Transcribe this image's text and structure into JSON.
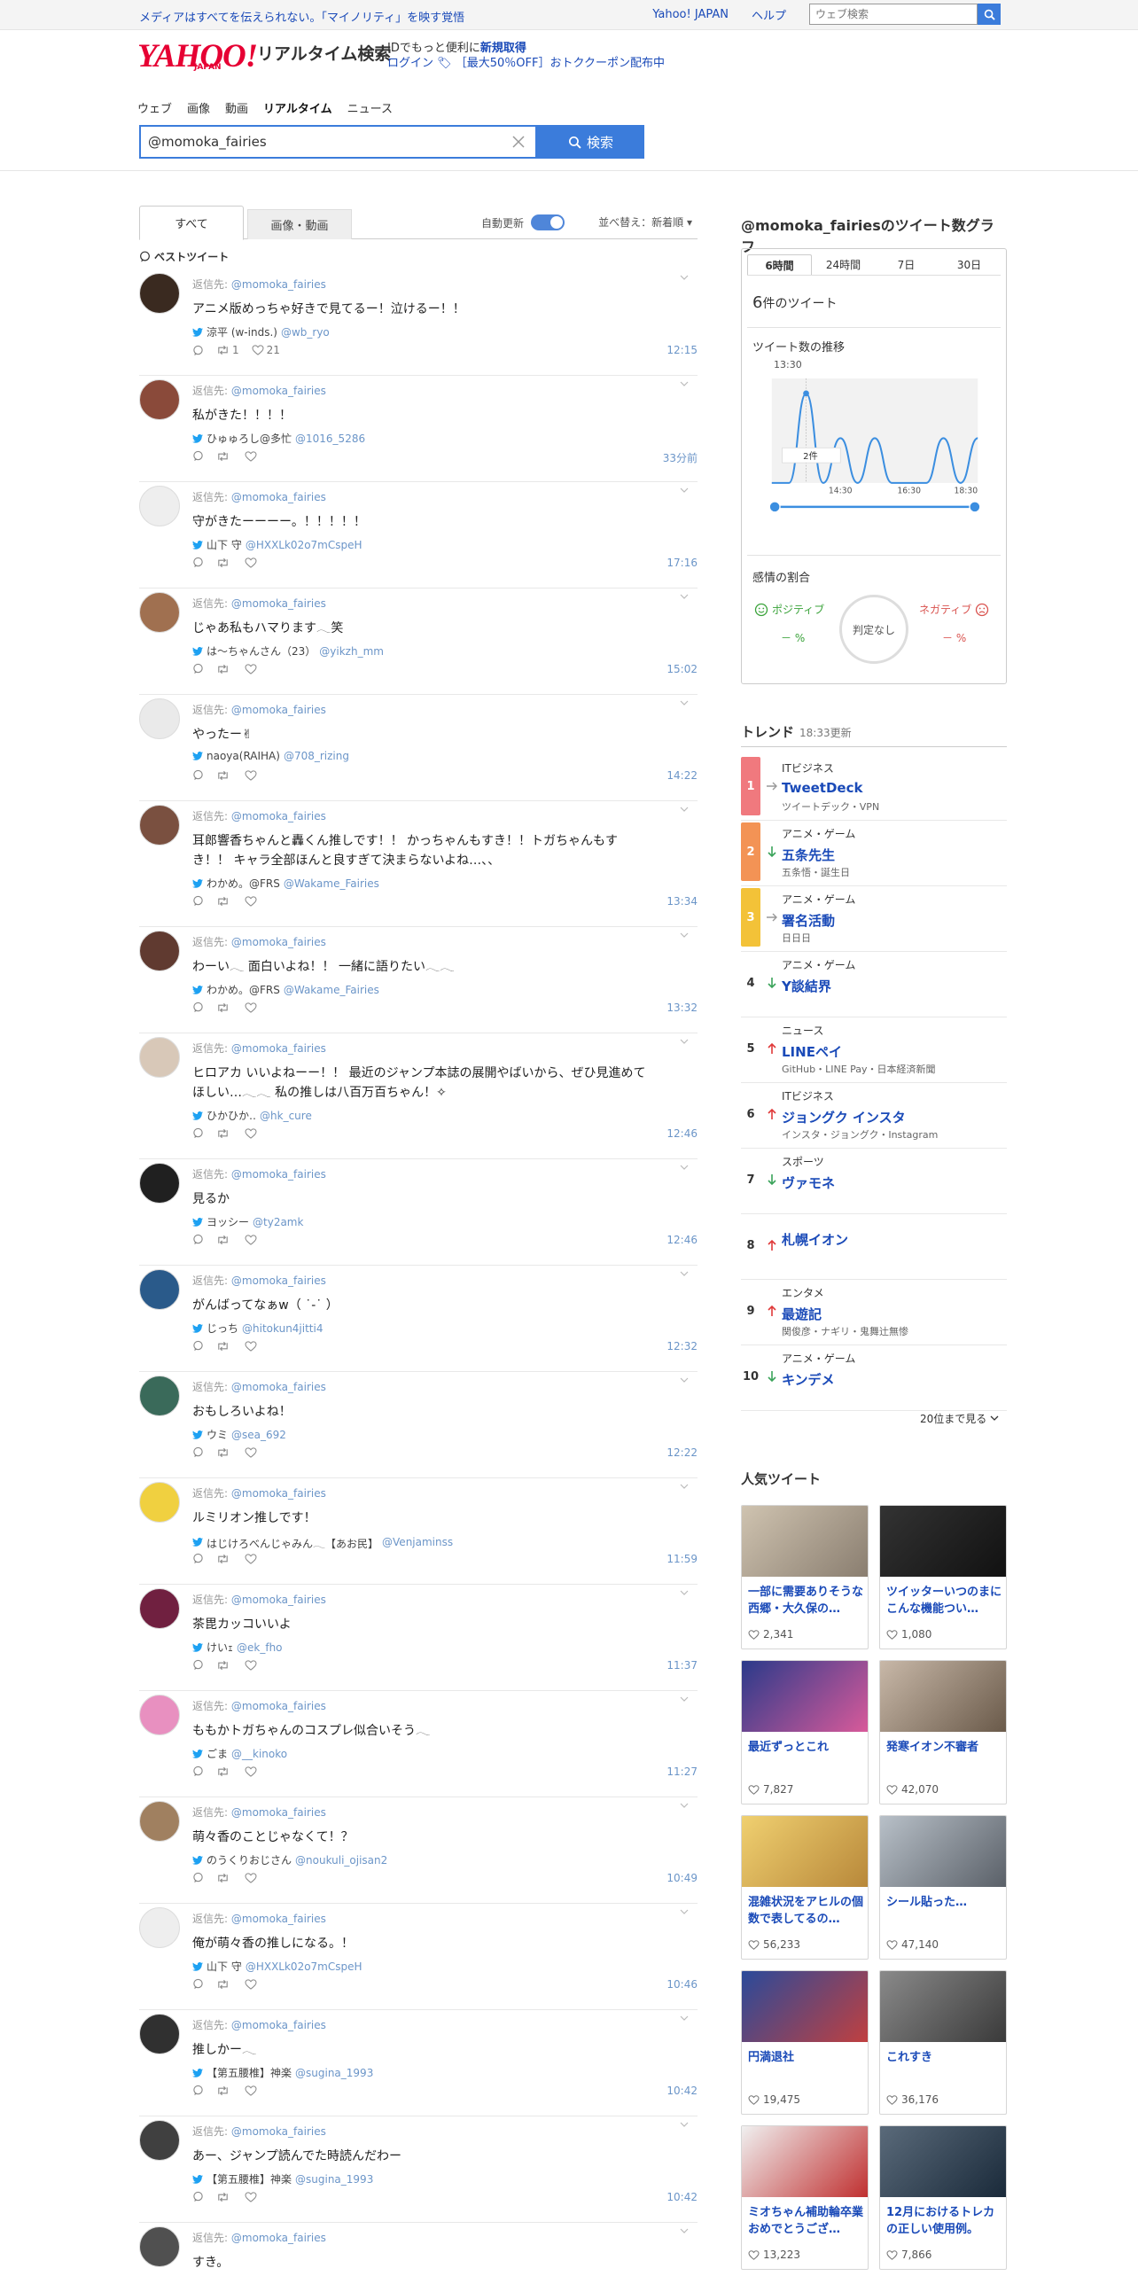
{
  "header": {
    "tagline": "メディアはすべてを伝えられない。「マイノリティ」を映す覚悟",
    "links": [
      "Yahoo! JAPAN",
      "ヘルプ"
    ],
    "top_search_placeholder": "ウェブ検索",
    "logo_text": "YAHOO!",
    "logo_sub": "JAPAN",
    "service_title": "リアルタイム検索",
    "promo_line1_prefix": "IDでもっと便利に",
    "promo_line1_link": "新規取得",
    "promo_line2": "ログイン  🏷 ［最大50％OFF］おトククーポン配布中"
  },
  "nav": [
    "ウェブ",
    "画像",
    "動画",
    "リアルタイム",
    "ニュース"
  ],
  "search": {
    "query": "@momoka_fairies",
    "button": "検索"
  },
  "timeline": {
    "tab_all": "すべて",
    "tab_media": "画像・動画",
    "auto_update": "自動更新",
    "sort": "並べ替え：新着順 ▾",
    "best_label": "ベストツイート",
    "reply_prefix": "返信先:",
    "reply_handle": "@momoka_fairies",
    "tweets": [
      {
        "text": "アニメ版めっちゃ好きで見てるー！泣けるー！！",
        "name": "涼平 (w-inds.)",
        "handle": "@wb_ryo",
        "rt": "1",
        "likes": "21",
        "time": "12:15"
      },
      {
        "text": "私がきた！！！！",
        "name": "ひゅゅろし@多忙",
        "handle": "@1016_5286",
        "rt": "",
        "likes": "",
        "time": "33分前"
      },
      {
        "text": "守がきたーーーー。！！！！！",
        "name": "山下 守",
        "handle": "@HXXLk02o7mCspeH",
        "rt": "",
        "likes": "",
        "time": "17:16"
      },
      {
        "text": "じゃあ私もハマります𓂃笑",
        "name": "は～ちゃんさん（23）",
        "handle": "@yikzh_mm",
        "rt": "",
        "likes": "",
        "time": "15:02"
      },
      {
        "text": "やったー✌",
        "name": "naoya(RAIHA)",
        "handle": "@708_rizing",
        "rt": "",
        "likes": "",
        "time": "14:22"
      },
      {
        "text": "耳郎響香ちゃんと轟くん推しです！！ かっちゃんもすき！！トガちゃんもすき！！ キャラ全部ほんと良すぎて決まらないよね…、、",
        "name": "わかめ。@FRS",
        "handle": "@Wakame_Fairies",
        "rt": "",
        "likes": "",
        "time": "13:34"
      },
      {
        "text": "わーい𓂃 面白いよね！！ 一緒に語りたい𓂃𓂃",
        "name": "わかめ。@FRS",
        "handle": "@Wakame_Fairies",
        "rt": "",
        "likes": "",
        "time": "13:32"
      },
      {
        "text": "ヒロアカ いいよねーー！！ 最近のジャンプ本誌の展開やばいから、ぜひ見進めてほしい…𓂃𓂃 私の推しは八百万百ちゃん！✧",
        "name": "ひかひか‥",
        "handle": "@hk_cure",
        "rt": "",
        "likes": "",
        "time": "12:46"
      },
      {
        "text": "見るか",
        "name": "ヨッシー",
        "handle": "@ty2amk",
        "rt": "",
        "likes": "",
        "time": "12:46"
      },
      {
        "text": "がんばってなぁw（ ˙-˙ ）",
        "name": "じっち",
        "handle": "@hitokun4jitti4",
        "rt": "",
        "likes": "",
        "time": "12:32"
      },
      {
        "text": "おもしろいよね！",
        "name": "ウミ",
        "handle": "@sea_692",
        "rt": "",
        "likes": "",
        "time": "12:22"
      },
      {
        "text": "ルミリオン推しです！",
        "name": "はじけろべんじゃみん𓂃【あお民】",
        "handle": "@Venjaminss",
        "rt": "",
        "likes": "",
        "time": "11:59"
      },
      {
        "text": "茶毘カッコいいよ",
        "name": "けいｪ",
        "handle": "@ek_fho",
        "rt": "",
        "likes": "",
        "time": "11:37"
      },
      {
        "text": "ももかトガちゃんのコスプレ似合いそう𓂃",
        "name": "ごま",
        "handle": "@__kinoko",
        "rt": "",
        "likes": "",
        "time": "11:27"
      },
      {
        "text": "萌々香のことじゃなくて！？",
        "name": "のうくりおじさん",
        "handle": "@noukuli_ojisan2",
        "rt": "",
        "likes": "",
        "time": "10:49"
      },
      {
        "text": "俺が萌々香の推しになる。！",
        "name": "山下 守",
        "handle": "@HXXLk02o7mCspeH",
        "rt": "",
        "likes": "",
        "time": "10:46"
      },
      {
        "text": "推しかー𓂃",
        "name": "【第五腰椎】神楽",
        "handle": "@sugina_1993",
        "rt": "",
        "likes": "",
        "time": "10:42"
      },
      {
        "text": "あー、ジャンプ読んでた時読んだわー",
        "name": "【第五腰椎】神楽",
        "handle": "@sugina_1993",
        "rt": "",
        "likes": "",
        "time": "10:42"
      },
      {
        "text": "すき。",
        "name": "",
        "handle": "",
        "rt": "",
        "likes": "",
        "time": ""
      }
    ]
  },
  "graph": {
    "title": "@momoka_fairiesのツイート数グラフ",
    "tabs": [
      "6時間",
      "24時間",
      "7日",
      "30日"
    ],
    "count": "6",
    "count_suffix": "件のツイート",
    "trend_label": "ツイート数の推移",
    "hover_time": "13:30",
    "hover_value": "2件",
    "x_ticks": [
      "14:30",
      "16:30",
      "18:30"
    ],
    "sentiment_title": "感情の割合",
    "positive": "ポジティブ",
    "negative": "ネガティブ",
    "pos_value": "－ %",
    "neg_value": "－ %",
    "judge": "判定なし",
    "chart_data": {
      "type": "line",
      "x": [
        "12:30",
        "13:00",
        "13:30",
        "14:00",
        "14:30",
        "15:00",
        "15:30",
        "16:00",
        "16:30",
        "17:00",
        "17:30",
        "18:00",
        "18:30"
      ],
      "values": [
        0,
        0,
        2,
        0,
        1,
        0,
        1,
        0,
        0,
        0,
        1,
        0,
        1
      ],
      "ylim": [
        0,
        2
      ]
    }
  },
  "trends": {
    "title": "トレンド",
    "updated": "18:33更新",
    "items": [
      {
        "rank": "1",
        "cat": "ITビジネス",
        "kw": "TweetDeck",
        "sub": "ツイートデック・VPN",
        "dir": "flat",
        "color": "#f0797e"
      },
      {
        "rank": "2",
        "cat": "アニメ・ゲーム",
        "kw": "五条先生",
        "sub": "五条悟・誕生日",
        "dir": "down",
        "color": "#f39355"
      },
      {
        "rank": "3",
        "cat": "アニメ・ゲーム",
        "kw": "署名活動",
        "sub": "日日日",
        "dir": "flat",
        "color": "#f3c238"
      },
      {
        "rank": "4",
        "cat": "アニメ・ゲーム",
        "kw": "Y談結界",
        "sub": "",
        "dir": "down",
        "color": ""
      },
      {
        "rank": "5",
        "cat": "ニュース",
        "kw": "LINEペイ",
        "sub": "GitHub・LINE Pay・日本経済新聞",
        "dir": "up",
        "color": ""
      },
      {
        "rank": "6",
        "cat": "ITビジネス",
        "kw": "ジョングク インスタ",
        "sub": "インスタ・ジョングク・Instagram",
        "dir": "up",
        "color": ""
      },
      {
        "rank": "7",
        "cat": "スポーツ",
        "kw": "ヴァモネ",
        "sub": "",
        "dir": "down",
        "color": ""
      },
      {
        "rank": "8",
        "cat": "",
        "kw": "札幌イオン",
        "sub": "",
        "dir": "up",
        "color": ""
      },
      {
        "rank": "9",
        "cat": "エンタメ",
        "kw": "最遊記",
        "sub": "関俊彦・ナギリ・鬼舞辻無惨",
        "dir": "up",
        "color": ""
      },
      {
        "rank": "10",
        "cat": "アニメ・ゲーム",
        "kw": "キンデメ",
        "sub": "",
        "dir": "down",
        "color": ""
      }
    ],
    "more": "20位まで見る"
  },
  "popular": {
    "title": "人気ツイート",
    "cards": [
      {
        "title": "一部に需要ありそうな西郷・大久保の…",
        "likes": "2,341"
      },
      {
        "title": "ツイッターいつのまにこんな機能つい…",
        "likes": "1,080"
      },
      {
        "title": "最近ずっとこれ",
        "likes": "7,827"
      },
      {
        "title": "発寒イオン不審者",
        "likes": "42,070"
      },
      {
        "title": "混雑状況をアヒルの個数で表してるの…",
        "likes": "56,233"
      },
      {
        "title": "シール貼った…",
        "likes": "47,140"
      },
      {
        "title": "円満退社",
        "likes": "19,475"
      },
      {
        "title": "これすき",
        "likes": "36,176"
      },
      {
        "title": "ミオちゃん補助輪卒業おめでとうござ…",
        "likes": "13,223"
      },
      {
        "title": "12月におけるトレカの正しい使用例。",
        "likes": "7,866"
      }
    ]
  },
  "colors": {
    "accent": "#3b7cdb",
    "link": "#1a4ab8",
    "handle": "#6b95c8",
    "brand": "#e60033"
  }
}
